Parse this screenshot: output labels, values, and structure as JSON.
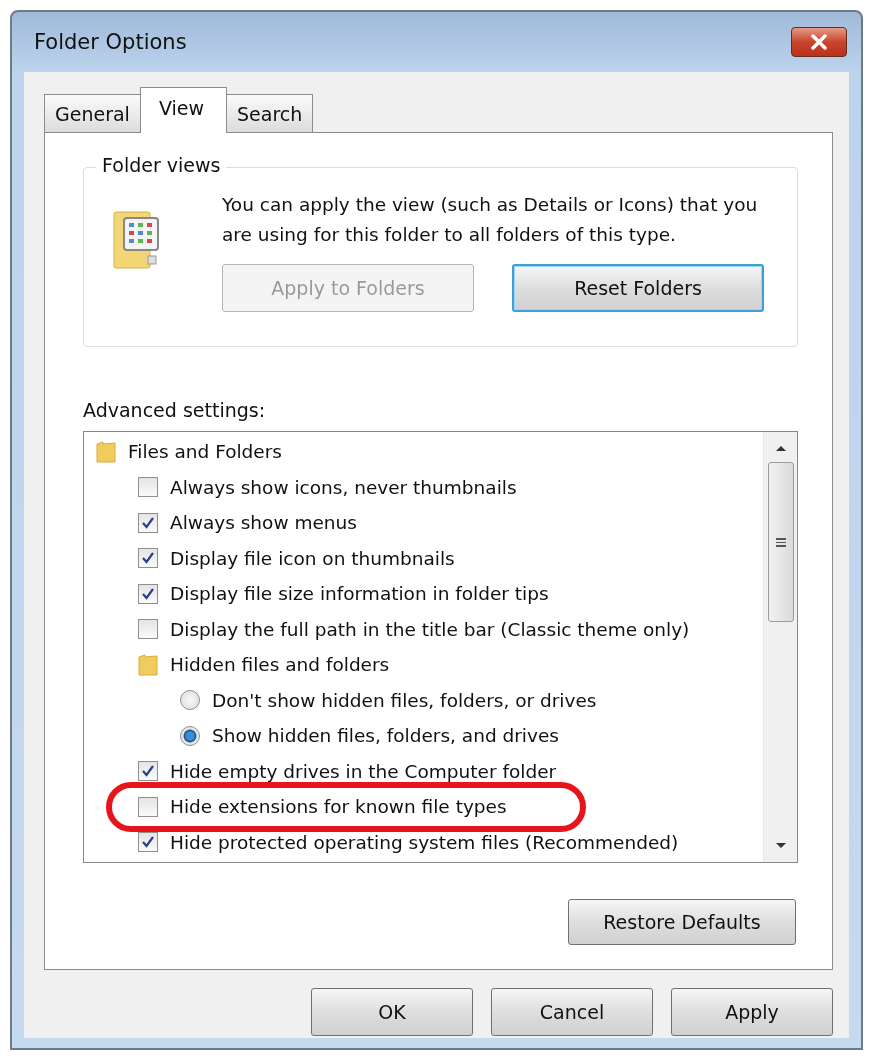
{
  "window": {
    "title": "Folder Options"
  },
  "tabs": [
    {
      "label": "General",
      "selected": false
    },
    {
      "label": "View",
      "selected": true
    },
    {
      "label": "Search",
      "selected": false
    }
  ],
  "folder_views": {
    "legend": "Folder views",
    "description": "You can apply the view (such as Details or Icons) that you are using for this folder to all folders of this type.",
    "buttons": [
      {
        "label": "Apply to Folders",
        "disabled": true
      },
      {
        "label": "Reset Folders",
        "disabled": false
      }
    ]
  },
  "advanced": {
    "label": "Advanced settings:",
    "items": [
      {
        "kind": "folder",
        "label": "Files and Folders",
        "children": [
          {
            "kind": "checkbox",
            "label": "Always show icons, never thumbnails",
            "checked": false,
            "highlighted": false
          },
          {
            "kind": "checkbox",
            "label": "Always show menus",
            "checked": true,
            "highlighted": false
          },
          {
            "kind": "checkbox",
            "label": "Display file icon on thumbnails",
            "checked": true,
            "highlighted": false
          },
          {
            "kind": "checkbox",
            "label": "Display file size information in folder tips",
            "checked": true,
            "highlighted": false
          },
          {
            "kind": "checkbox",
            "label": "Display the full path in the title bar (Classic theme only)",
            "checked": false,
            "highlighted": false
          },
          {
            "kind": "folder",
            "label": "Hidden files and folders",
            "children": [
              {
                "kind": "radio",
                "label": "Don't show hidden files, folders, or drives",
                "selected": false
              },
              {
                "kind": "radio",
                "label": "Show hidden files, folders, and drives",
                "selected": true
              }
            ]
          },
          {
            "kind": "checkbox",
            "label": "Hide empty drives in the Computer folder",
            "checked": true,
            "highlighted": false
          },
          {
            "kind": "checkbox",
            "label": "Hide extensions for known file types",
            "checked": false,
            "highlighted": true
          },
          {
            "kind": "checkbox",
            "label": "Hide protected operating system files (Recommended)",
            "checked": true,
            "highlighted": false
          }
        ]
      }
    ]
  },
  "restore_button": "Restore Defaults",
  "dialog_buttons": [
    "OK",
    "Cancel",
    "Apply"
  ]
}
